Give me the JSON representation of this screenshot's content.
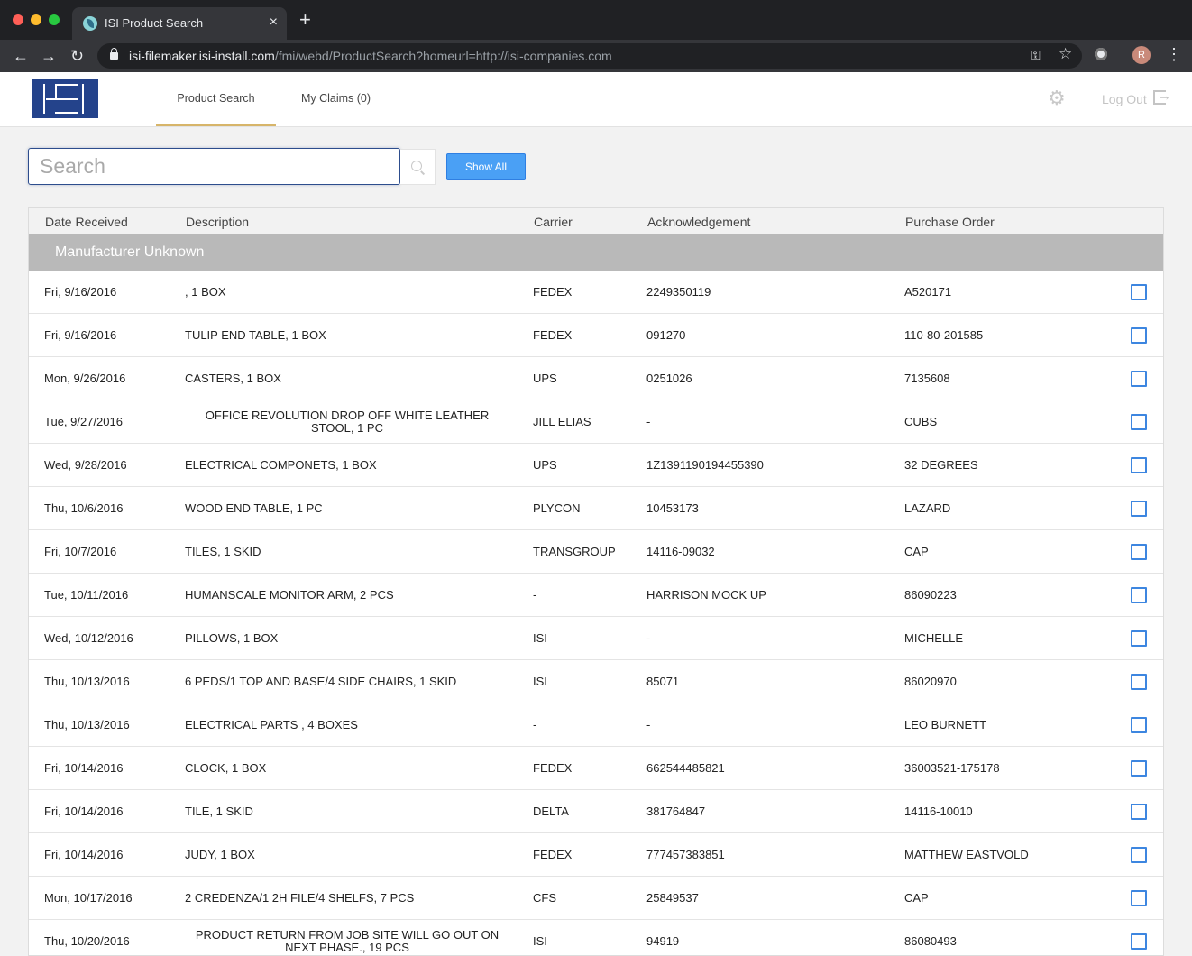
{
  "browser": {
    "tab_title": "ISI Product Search",
    "tab_close": "×",
    "new_tab": "+",
    "url_host": "isi-filemaker.isi-install.com",
    "url_path": "/fmi/webd/ProductSearch?homeurl=http://isi-companies.com",
    "profile_initial": "R"
  },
  "header": {
    "nav": [
      {
        "label": "Product Search",
        "active": true
      },
      {
        "label": "My Claims (0)",
        "active": false
      }
    ],
    "logout_label": "Log Out",
    "accent_color": "#d7b56a",
    "logo_color": "#24438b"
  },
  "search": {
    "placeholder": "Search",
    "value": "",
    "show_all_label": "Show All"
  },
  "table": {
    "columns": [
      "Date Received",
      "Description",
      "Carrier",
      "Acknowledgement",
      "Purchase Order"
    ],
    "group_label": "Manufacturer Unknown",
    "rows": [
      {
        "date": "Fri, 9/16/2016",
        "desc": ", 1 BOX",
        "carrier": "FEDEX",
        "ack": "2249350119",
        "po": "A520171"
      },
      {
        "date": "Fri, 9/16/2016",
        "desc": "TULIP END TABLE, 1 BOX",
        "carrier": "FEDEX",
        "ack": "091270",
        "po": "110-80-201585"
      },
      {
        "date": "Mon, 9/26/2016",
        "desc": "CASTERS, 1 BOX",
        "carrier": "UPS",
        "ack": "0251026",
        "po": "7135608"
      },
      {
        "date": "Tue, 9/27/2016",
        "desc": "OFFICE REVOLUTION DROP OFF WHITE LEATHER STOOL, 1 PC",
        "carrier": "JILL ELIAS",
        "ack": "-",
        "po": "CUBS"
      },
      {
        "date": "Wed, 9/28/2016",
        "desc": "ELECTRICAL COMPONETS, 1 BOX",
        "carrier": "UPS",
        "ack": "1Z1391190194455390",
        "po": "32 DEGREES"
      },
      {
        "date": "Thu, 10/6/2016",
        "desc": "WOOD END TABLE, 1 PC",
        "carrier": "PLYCON",
        "ack": "10453173",
        "po": "LAZARD"
      },
      {
        "date": "Fri, 10/7/2016",
        "desc": "TILES, 1 SKID",
        "carrier": "TRANSGROUP",
        "ack": "14116-09032",
        "po": "CAP"
      },
      {
        "date": "Tue, 10/11/2016",
        "desc": "HUMANSCALE MONITOR ARM, 2 PCS",
        "carrier": "-",
        "ack": "HARRISON MOCK UP",
        "po": "86090223"
      },
      {
        "date": "Wed, 10/12/2016",
        "desc": "PILLOWS, 1 BOX",
        "carrier": "ISI",
        "ack": "-",
        "po": "MICHELLE"
      },
      {
        "date": "Thu, 10/13/2016",
        "desc": "6 PEDS/1 TOP AND BASE/4 SIDE CHAIRS, 1 SKID",
        "carrier": "ISI",
        "ack": "85071",
        "po": "86020970"
      },
      {
        "date": "Thu, 10/13/2016",
        "desc": "ELECTRICAL PARTS , 4 BOXES",
        "carrier": "-",
        "ack": "-",
        "po": "LEO BURNETT"
      },
      {
        "date": "Fri, 10/14/2016",
        "desc": "CLOCK, 1 BOX",
        "carrier": "FEDEX",
        "ack": "662544485821",
        "po": "36003521-175178"
      },
      {
        "date": "Fri, 10/14/2016",
        "desc": "TILE, 1 SKID",
        "carrier": "DELTA",
        "ack": "381764847",
        "po": "14116-10010"
      },
      {
        "date": "Fri, 10/14/2016",
        "desc": "JUDY, 1 BOX",
        "carrier": "FEDEX",
        "ack": "777457383851",
        "po": "MATTHEW EASTVOLD"
      },
      {
        "date": "Mon, 10/17/2016",
        "desc": "2 CREDENZA/1 2H FILE/4 SHELFS, 7 PCS",
        "carrier": "CFS",
        "ack": "25849537",
        "po": "CAP"
      },
      {
        "date": "Thu, 10/20/2016",
        "desc": "PRODUCT RETURN FROM JOB SITE WILL GO OUT ON NEXT PHASE., 19 PCS",
        "carrier": "ISI",
        "ack": "94919",
        "po": "86080493"
      }
    ]
  }
}
